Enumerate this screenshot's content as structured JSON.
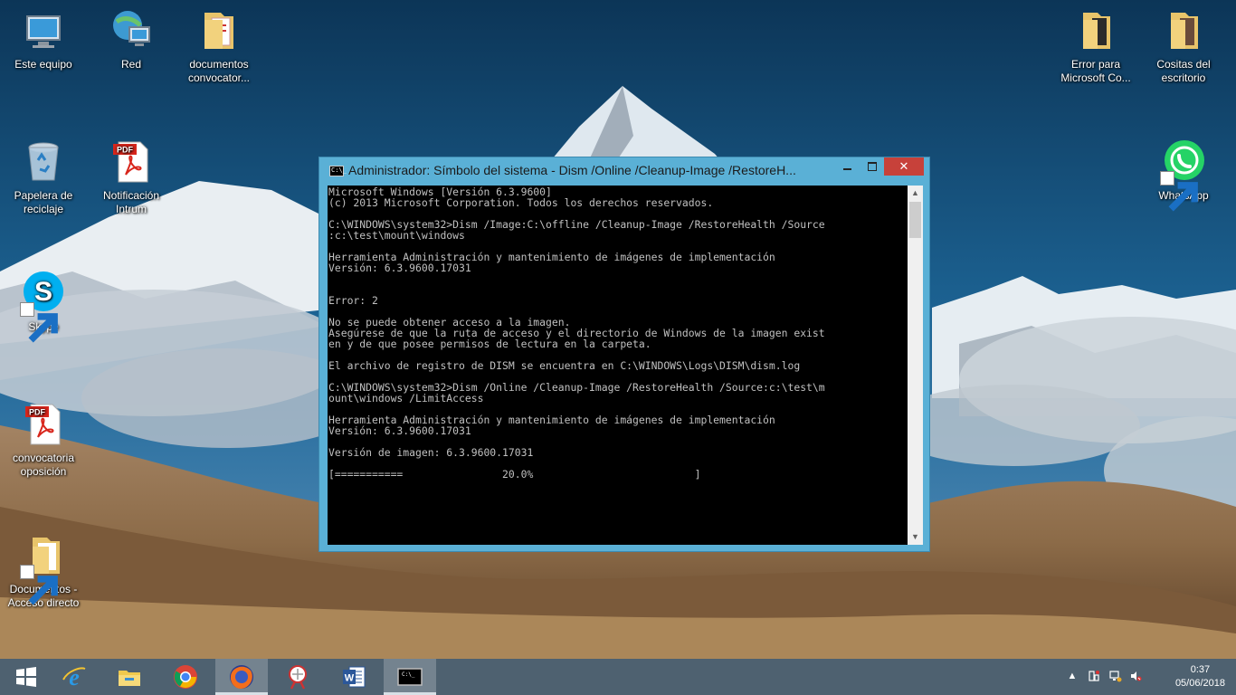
{
  "desktop": {
    "left_icons": [
      {
        "label": "Este equipo",
        "icon": "this-pc-icon"
      },
      {
        "label": "Red",
        "icon": "network-icon"
      },
      {
        "label": "documentos convocator...",
        "icon": "folder-icon"
      },
      {
        "label": "Papelera de reciclaje",
        "icon": "recycle-bin-icon"
      },
      {
        "label": "Notificación Intrum",
        "icon": "pdf-icon"
      },
      {
        "label": "Skype",
        "icon": "skype-icon"
      },
      {
        "label": "convocatoria oposición",
        "icon": "pdf-icon"
      },
      {
        "label": "Documentos - Acceso directo",
        "icon": "folder-shortcut-icon"
      }
    ],
    "right_icons": [
      {
        "label": "Error para Microsoft Co...",
        "icon": "folder-icon"
      },
      {
        "label": "Cositas del escritorio",
        "icon": "folder-icon"
      },
      {
        "label": "WhatsApp",
        "icon": "whatsapp-icon"
      }
    ]
  },
  "cmd_window": {
    "title": "Administrador: Símbolo del sistema - Dism  /Online /Cleanup-Image /RestoreH...",
    "icon_text": "C:\\_",
    "minimize_label": "–",
    "maximize_label": "□",
    "close_label": "✕",
    "lines": [
      "Microsoft Windows [Versión 6.3.9600]",
      "(c) 2013 Microsoft Corporation. Todos los derechos reservados.",
      "",
      "C:\\WINDOWS\\system32>Dism /Image:C:\\offline /Cleanup-Image /RestoreHealth /Source",
      ":c:\\test\\mount\\windows",
      "",
      "Herramienta Administración y mantenimiento de imágenes de implementación",
      "Versión: 6.3.9600.17031",
      "",
      "",
      "Error: 2",
      "",
      "No se puede obtener acceso a la imagen.",
      "Asegúrese de que la ruta de acceso y el directorio de Windows de la imagen exist",
      "en y de que posee permisos de lectura en la carpeta.",
      "",
      "El archivo de registro de DISM se encuentra en C:\\WINDOWS\\Logs\\DISM\\dism.log",
      "",
      "C:\\WINDOWS\\system32>Dism /Online /Cleanup-Image /RestoreHealth /Source:c:\\test\\m",
      "ount\\windows /LimitAccess",
      "",
      "Herramienta Administración y mantenimiento de imágenes de implementación",
      "Versión: 6.3.9600.17031",
      "",
      "Versión de imagen: 6.3.9600.17031",
      "",
      "[===========                20.0%                          ]"
    ],
    "progress_percent": 20.0
  },
  "taskbar": {
    "start": "start-icon",
    "pinned": [
      {
        "name": "internet-explorer-icon",
        "active": false
      },
      {
        "name": "file-explorer-icon",
        "active": false
      },
      {
        "name": "chrome-icon",
        "active": false
      },
      {
        "name": "firefox-icon",
        "active": true
      },
      {
        "name": "snipping-tool-icon",
        "active": false
      },
      {
        "name": "word-icon",
        "active": false
      },
      {
        "name": "command-prompt-icon",
        "active": true
      }
    ],
    "tray": {
      "overflow_label": "▲",
      "time": "0:37",
      "date": "05/06/2018"
    }
  },
  "colors": {
    "window_frame": "#5ab0d6",
    "close_button": "#c7413a",
    "console_bg": "#000000",
    "console_text": "#c0c0c0",
    "taskbar": "#4e6170"
  }
}
